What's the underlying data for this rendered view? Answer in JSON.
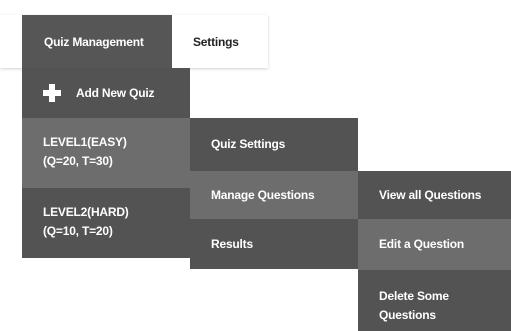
{
  "nav": {
    "tabs": [
      {
        "label": "Quiz Management"
      },
      {
        "label": "Settings"
      }
    ]
  },
  "menu": {
    "add_label": "Add New Quiz",
    "add_icon": "plus-icon",
    "levels": [
      {
        "line1": "LEVEL1(EASY)",
        "line2": "(Q=20, T=30)"
      },
      {
        "line1": "LEVEL2(HARD)",
        "line2": "(Q=10, T=20)"
      }
    ],
    "level_menu": [
      {
        "label": "Quiz Settings"
      },
      {
        "label": "Manage Questions"
      },
      {
        "label": "Results"
      }
    ],
    "question_menu": [
      {
        "label": "View all Questions"
      },
      {
        "label": "Edit a Question"
      },
      {
        "line1": "Delete Some",
        "line2": "Questions"
      }
    ]
  },
  "colors": {
    "menu_dark": "#535353",
    "menu_highlight": "#6d6d6d",
    "text_light": "#ffffff",
    "text_dark": "#222222"
  }
}
